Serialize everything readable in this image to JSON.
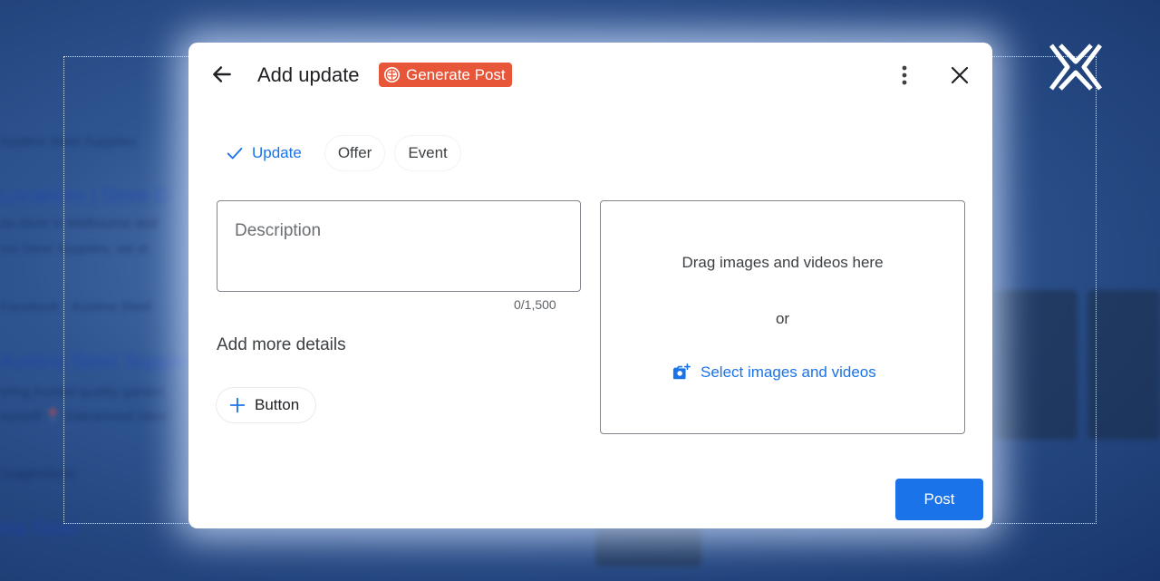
{
  "background": {
    "lines": [
      "Austina Steel Supplies",
      "Locations | Store D",
      "ex-store in Melbourne and",
      "ina Steel Supplies, we st",
      "Facebook · Austina Steel",
      "Austina Steel Supplies",
      "ering trusted quality garden",
      "ourself 📍 Galvanised Steel",
      "Suggestions",
      "ina Steel"
    ]
  },
  "dialog": {
    "title": "Add update",
    "generate_label": "Generate Post",
    "tabs": [
      {
        "label": "Update",
        "active": true
      },
      {
        "label": "Offer",
        "active": false
      },
      {
        "label": "Event",
        "active": false
      }
    ],
    "description_placeholder": "Description",
    "char_counter": "0/1,500",
    "more_details_heading": "Add more details",
    "add_button_label": "Button",
    "drop_zone": {
      "drag_text": "Drag images and videos here",
      "or_text": "or",
      "select_label": "Select images and videos"
    },
    "post_label": "Post"
  },
  "colors": {
    "accent": "#1a73e8",
    "generate_badge": "#e8563a"
  },
  "icons": {
    "back": "arrow-left-icon",
    "brain": "brain-icon",
    "more": "more-vert-icon",
    "close": "close-icon",
    "check": "check-icon",
    "plus": "plus-icon",
    "add_photo": "add-photo-icon",
    "brand": "brand-logo-icon"
  }
}
